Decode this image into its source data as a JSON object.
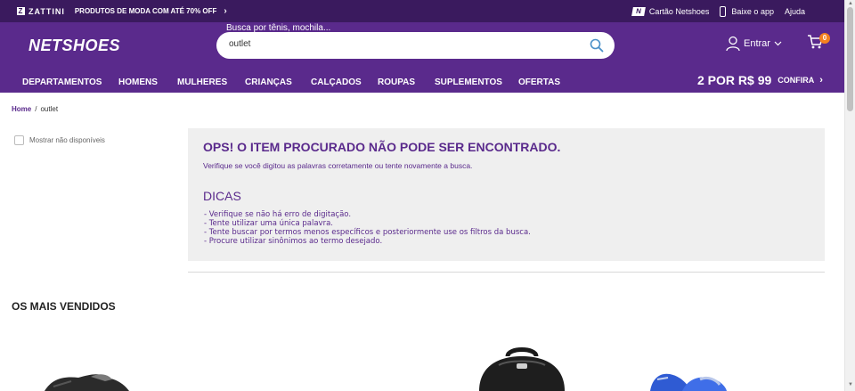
{
  "topbar": {
    "brand": "ZATTINI",
    "brand_mark": "Z",
    "promo": "PRODUTOS DE MODA COM ATÉ 70% OFF",
    "promo_chevron": "›",
    "card_mark": "N",
    "card_label": "Cartão Netshoes",
    "app_label": "Baixe o app",
    "help_label": "Ajuda"
  },
  "header": {
    "logo": "NETSHOES",
    "search_label": "Busca por tênis, mochila...",
    "search_value": "outlet",
    "login_label": "Entrar",
    "cart_count": "0",
    "nav": [
      {
        "label": "DEPARTAMENTOS"
      },
      {
        "label": "HOMENS"
      },
      {
        "label": "MULHERES"
      },
      {
        "label": "CRIANÇAS"
      },
      {
        "label": "CALÇADOS"
      },
      {
        "label": "ROUPAS"
      },
      {
        "label": "SUPLEMENTOS"
      },
      {
        "label": "OFERTAS"
      }
    ],
    "promo_big": "2 POR R$ 99",
    "promo_small": "CONFIRA",
    "promo_chevron": "›"
  },
  "breadcrumb": {
    "home": "Home",
    "separator": "/",
    "current": "outlet"
  },
  "filter": {
    "unavailable_label": "Mostrar não disponíveis"
  },
  "not_found": {
    "title": "OPS! O ITEM PROCURADO NÃO PODE SER ENCONTRADO.",
    "subtitle": "Verifique se você digitou as palavras corretamente ou tente novamente a busca.",
    "tips_title": "DICAS",
    "tips": [
      "- Verifique se não há erro de digitação.",
      "- Tente utilizar uma única palavra.",
      "- Tente buscar por termos menos específicos e posteriormente use os filtros da busca.",
      "- Procure utilizar sinônimos ao termo desejado."
    ]
  },
  "best_sellers": {
    "title": "OS MAIS VENDIDOS"
  },
  "colors": {
    "topbar": "#3a1a5e",
    "header": "#5a2a8c",
    "accent": "#f5821f",
    "text_purple": "#5a2a8c",
    "panel": "#efefef"
  },
  "icons": [
    "search-icon",
    "user-icon",
    "cart-icon",
    "phone-icon",
    "card-icon",
    "chevron-right-icon",
    "chevron-down-icon"
  ]
}
